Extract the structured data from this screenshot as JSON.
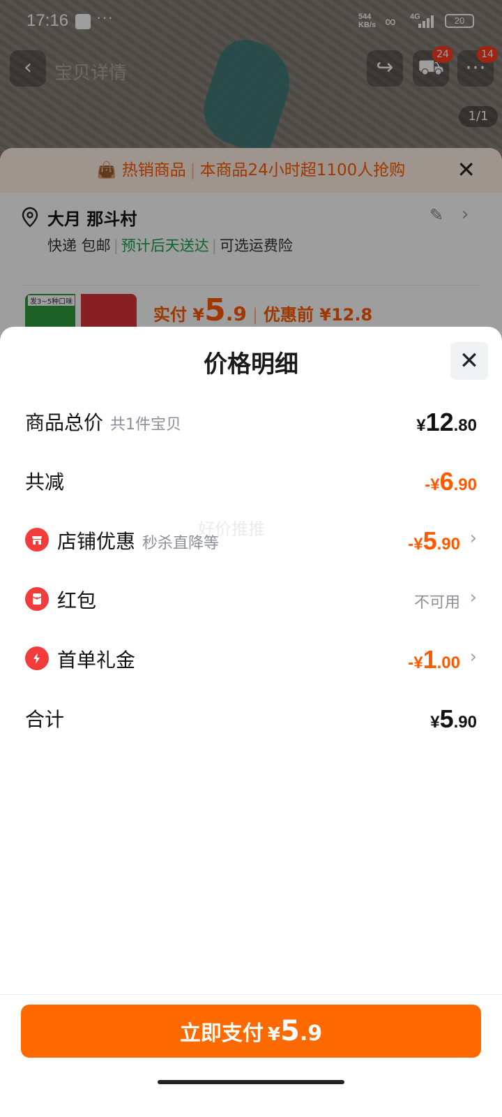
{
  "status_bar": {
    "time": "17:16",
    "more": "···",
    "speed_top": "544",
    "speed_bottom": "KB/s",
    "network": "4G",
    "battery": "20"
  },
  "product_page": {
    "nav_title": "宝贝详情",
    "cart_badge": "24",
    "more_badge": "14",
    "image_counter": "1/1"
  },
  "order_sheet": {
    "hot_label": "热销商品",
    "hot_text": "本商品24小时超1100人抢购",
    "address_name": "大月 那斗村",
    "ship_method": "快递 包邮",
    "ship_eta": "预计后天送达",
    "ship_insurance": "可选运费险",
    "thumb_tag": "发3~5种口味",
    "pay_label": "实付 ¥",
    "pay_int": "5",
    "pay_dec": ".9",
    "before_label": "优惠前 ¥12.8"
  },
  "price_detail": {
    "title": "价格明细",
    "watermark": "好价推推",
    "rows": {
      "total": {
        "label": "商品总价",
        "sub": "共1件宝贝",
        "sym": "¥",
        "int": "12",
        "dec": ".80"
      },
      "reduce": {
        "label": "共减",
        "sym": "-¥",
        "int": "6",
        "dec": ".90"
      },
      "shop": {
        "label": "店铺优惠",
        "sub": "秒杀直降等",
        "sym": "-¥",
        "int": "5",
        "dec": ".90"
      },
      "redpacket": {
        "label": "红包",
        "value": "不可用"
      },
      "first_order": {
        "label": "首单礼金",
        "sym": "-¥",
        "int": "1",
        "dec": ".00"
      },
      "sum": {
        "label": "合计",
        "sym": "¥",
        "int": "5",
        "dec": ".90"
      }
    }
  },
  "pay_button": {
    "label": "立即支付",
    "sym": "¥",
    "int": "5",
    "dec": ".9"
  },
  "colors": {
    "accent": "#ff6a00",
    "discount": "#ff5a00",
    "green": "#19a150",
    "icon_red": "#f23c3c"
  }
}
